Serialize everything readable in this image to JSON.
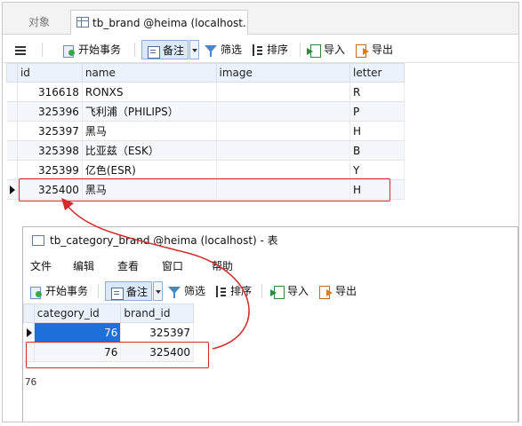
{
  "tabs": {
    "inactive_label": "对象",
    "active_label": "tb_brand @heima (localhost..."
  },
  "toolbar": {
    "begin_tx": "开始事务",
    "note": "备注",
    "filter": "筛选",
    "sort": "排序",
    "import": "导入",
    "export": "导出"
  },
  "brand_table": {
    "columns": [
      "id",
      "name",
      "image",
      "letter"
    ],
    "rows": [
      {
        "id": "316618",
        "name": "RONXS",
        "image": "",
        "letter": "R"
      },
      {
        "id": "325396",
        "name": "飞利浦（PHILIPS）",
        "image": "",
        "letter": "P"
      },
      {
        "id": "325397",
        "name": "黑马",
        "image": "",
        "letter": "H"
      },
      {
        "id": "325398",
        "name": "比亚兹（ESK）",
        "image": "",
        "letter": "B"
      },
      {
        "id": "325399",
        "name": "亿色(ESR)",
        "image": "",
        "letter": "Y"
      },
      {
        "id": "325400",
        "name": "黑马",
        "image": "",
        "letter": "H"
      }
    ]
  },
  "category_window": {
    "title": "tb_category_brand @heima (localhost) - 表",
    "menu": [
      "文件",
      "编辑",
      "查看",
      "窗口",
      "帮助"
    ],
    "toolbar": {
      "begin_tx": "开始事务",
      "note": "备注",
      "filter": "筛选",
      "sort": "排序",
      "import": "导入",
      "export": "导出"
    },
    "columns": [
      "category_id",
      "brand_id"
    ],
    "rows": [
      {
        "category_id": "76",
        "brand_id": "325397"
      },
      {
        "category_id": "76",
        "brand_id": "325400"
      }
    ],
    "status_value": "76"
  },
  "colors": {
    "highlight": "#d42a2a",
    "selection": "#1e6fd9",
    "header_bg": "#ebf2fb"
  }
}
